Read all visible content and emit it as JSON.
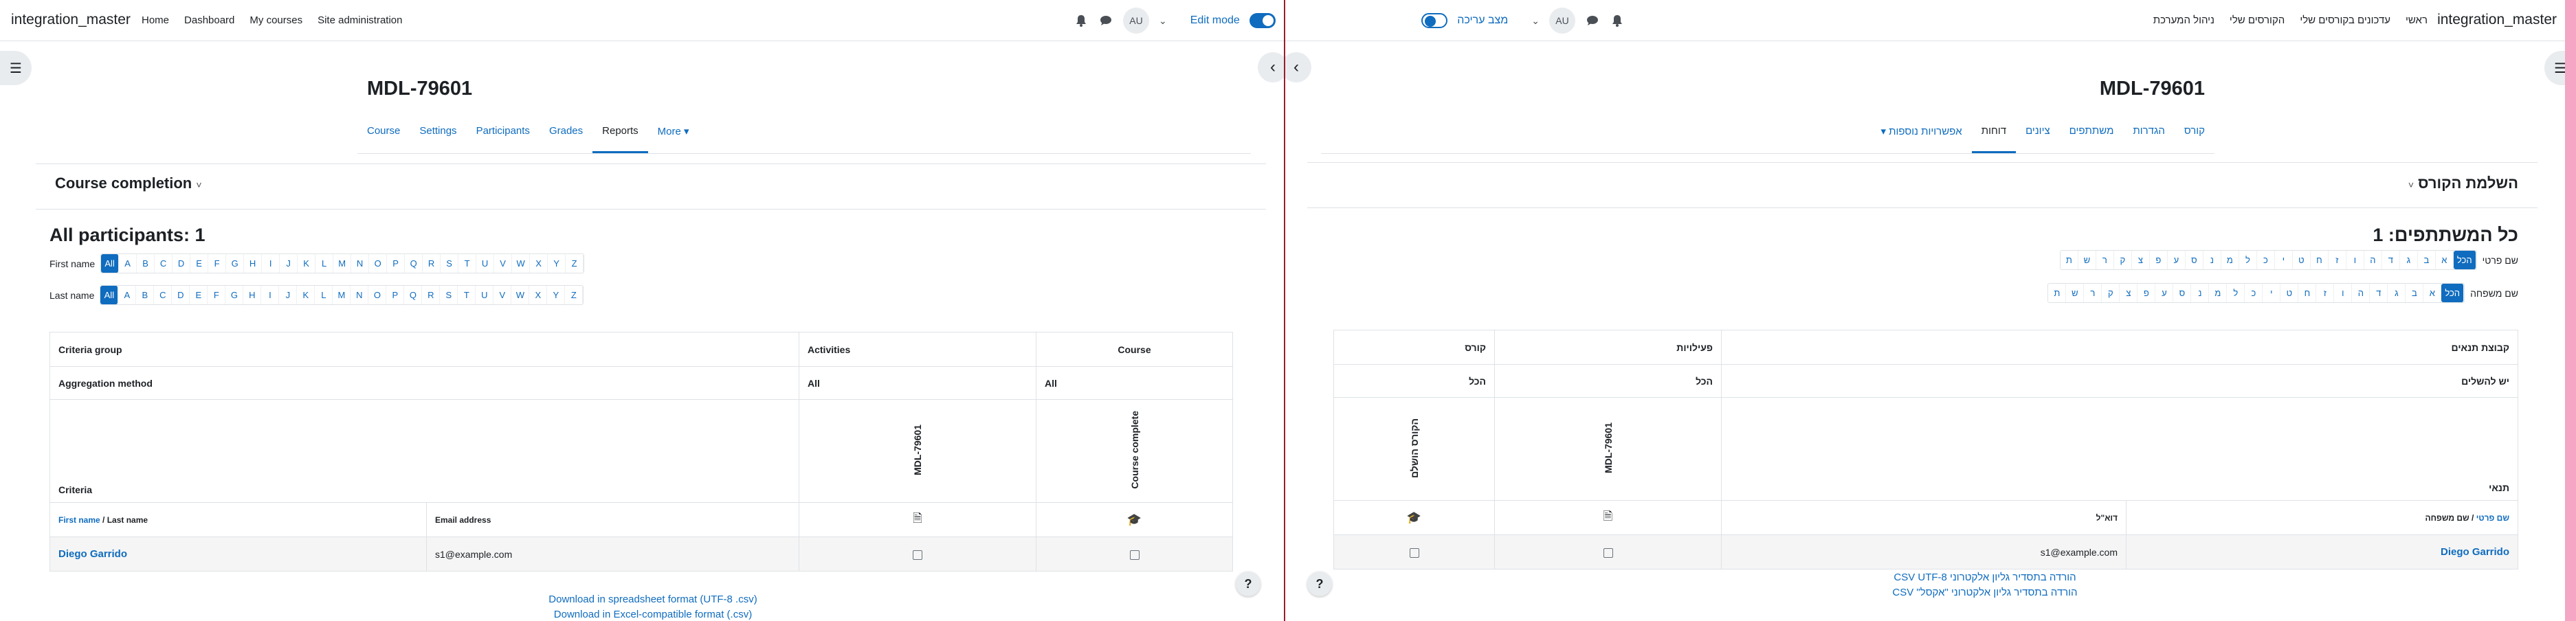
{
  "ltr": {
    "brand": "integration_master",
    "menu": [
      "Home",
      "Dashboard",
      "My courses",
      "Site administration"
    ],
    "avatar": "AU",
    "edit_mode": "Edit mode",
    "page_title": "MDL-79601",
    "tabs": [
      "Course",
      "Settings",
      "Participants",
      "Grades",
      "Reports",
      "More ▾"
    ],
    "active_tab": "Reports",
    "selector": "Course completion",
    "selector_caret": "˅",
    "all_participants": "All participants: 1",
    "first_name_label": "First name",
    "last_name_label": "Last name",
    "all_label": "All",
    "letters": [
      "A",
      "B",
      "C",
      "D",
      "E",
      "F",
      "G",
      "H",
      "I",
      "J",
      "K",
      "L",
      "M",
      "N",
      "O",
      "P",
      "Q",
      "R",
      "S",
      "T",
      "U",
      "V",
      "W",
      "X",
      "Y",
      "Z"
    ],
    "table": {
      "criteria_group": "Criteria group",
      "activities": "Activities",
      "course": "Course",
      "aggregation_method": "Aggregation method",
      "agg_all_1": "All",
      "agg_all_2": "All",
      "criteria": "Criteria",
      "crit_activity": "MDL-79601",
      "crit_course": "Course complete",
      "first_name": "First name",
      "sep": " / ",
      "last_name": "Last name",
      "email_address": "Email address",
      "user_name": "Diego Garrido",
      "user_email": "s1@example.com"
    },
    "download_csv": "Download in spreadsheet format (UTF-8 .csv)",
    "download_excel": "Download in Excel-compatible format (.csv)",
    "help": "?"
  },
  "rtl": {
    "brand": "integration_master",
    "menu": [
      "ראשי",
      "עדכונים בקורסים שלי",
      "הקורסים שלי",
      "ניהול המערכת"
    ],
    "avatar": "AU",
    "edit_mode": "מצב עריכה",
    "page_title": "MDL-79601",
    "tabs": [
      "קורס",
      "הגדרות",
      "משתתפים",
      "ציונים",
      "דוחות",
      "אפשרויות נוספות ▾"
    ],
    "active_tab": "דוחות",
    "selector": "השלמת הקורס",
    "selector_caret": "˅",
    "all_participants": "כל המשתתפים: 1",
    "first_name_label": "שם פרטי",
    "last_name_label": "שם משפחה",
    "all_label": "הכל",
    "letters": [
      "א",
      "ב",
      "ג",
      "ד",
      "ה",
      "ו",
      "ז",
      "ח",
      "ט",
      "י",
      "כ",
      "ל",
      "מ",
      "נ",
      "ס",
      "ע",
      "פ",
      "צ",
      "ק",
      "ר",
      "ש",
      "ת"
    ],
    "table": {
      "criteria_group": "קבוצת תנאים",
      "activities": "פעילויות",
      "course": "קורס",
      "aggregation_method": "יש להשלים",
      "agg_all_1": "הכל",
      "agg_all_2": "הכל",
      "criteria": "תנאי",
      "crit_activity": "MDL-79601",
      "crit_course": "הקורס הושלם",
      "first_name": "שם פרטי",
      "sep": " / ",
      "last_name": "שם משפחה",
      "email_address": "דוא\"ל",
      "user_name": "Diego Garrido",
      "user_email": "s1@example.com"
    },
    "download_csv": "הורדה בתסדיר גליון אלקטרוני CSV UTF-8",
    "download_excel": "הורדה בתסדיר גליון אלקטרוני \"אקסל\" CSV",
    "help": "?"
  },
  "colors": {
    "accent": "#0f6cbf",
    "divider": "#9a1c2d",
    "right_edge": "#f4a6c4"
  }
}
